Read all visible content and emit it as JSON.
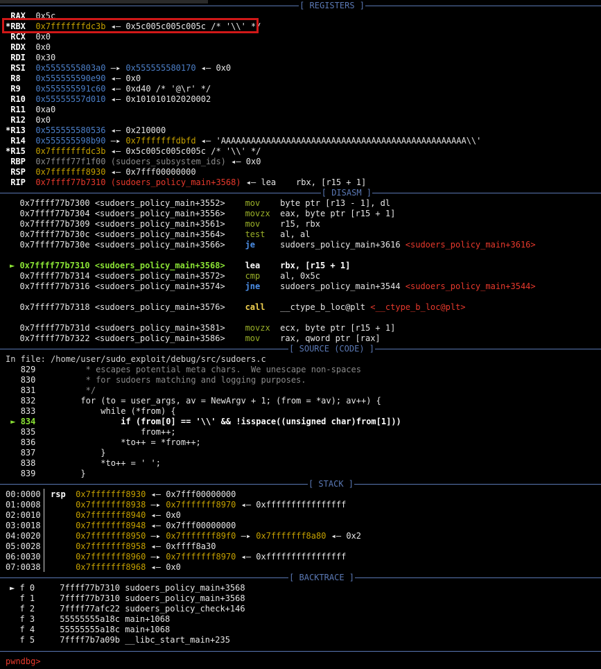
{
  "sections": {
    "registers": "[ REGISTERS ]",
    "disasm": "[ DISASM ]",
    "source": "[ SOURCE (CODE) ]",
    "stack": "[ STACK ]",
    "backtrace": "[ BACKTRACE ]"
  },
  "registers": [
    {
      "name": " RAX",
      "v1": "0x5c",
      "rest": ""
    },
    {
      "name": "*RBX",
      "v1": "0x7fffffffdc3b",
      "rest": " ◂— 0x5c005c005c005c /* '\\\\' */"
    },
    {
      "name": " RCX",
      "v1": "0x0",
      "rest": ""
    },
    {
      "name": " RDX",
      "v1": "0x0",
      "rest": ""
    },
    {
      "name": " RDI",
      "v1": "0x30",
      "rest": ""
    },
    {
      "name": " RSI",
      "v1": "0x5555555803a0",
      "mid": " —▸ ",
      "v2": "0x555555580170",
      "rest": " ◂— 0x0"
    },
    {
      "name": " R8",
      "v1": "0x555555590e90",
      "rest": " ◂— 0x0"
    },
    {
      "name": " R9",
      "v1": "0x555555591c60",
      "rest": " ◂— 0xd40 /* '@\\r' */"
    },
    {
      "name": " R10",
      "v1": "0x55555557d010",
      "rest": " ◂— 0x101010102020002"
    },
    {
      "name": " R11",
      "v1": "0xa0",
      "rest": ""
    },
    {
      "name": " R12",
      "v1": "0x0",
      "rest": ""
    },
    {
      "name": "*R13",
      "v1": "0x555555580536",
      "rest": " ◂— 0x210000"
    },
    {
      "name": " R14",
      "v1": "0x555555598b90",
      "mid": " —▸ ",
      "v2": "0x7fffffffdbfd",
      "rest": " ◂— 'AAAAAAAAAAAAAAAAAAAAAAAAAAAAAAAAAAAAAAAAAAAAAAAAA\\\\'"
    },
    {
      "name": "*R15",
      "v1": "0x7fffffffdc3b",
      "rest": " ◂— 0x5c005c005c005c /* '\\\\' */"
    },
    {
      "name": " RBP",
      "v1": "0x7ffff77f1f00 (sudoers_subsystem_ids)",
      "rest": " ◂— 0x0"
    },
    {
      "name": " RSP",
      "v1": "0x7fffffff8930",
      "rest": " ◂— 0x7fff00000000"
    },
    {
      "name": " RIP",
      "v1": "0x7ffff77b7310 (sudoers_policy_main+3568)",
      "rest": " ◂— lea    rbx, [r15 + 1]"
    }
  ],
  "disasm": [
    {
      "addr": "0x7ffff77b7300",
      "sym": "<sudoers_policy_main+3552>",
      "mn": "mov",
      "ops": "byte ptr [r13 - 1], dl",
      "cur": false
    },
    {
      "addr": "0x7ffff77b7304",
      "sym": "<sudoers_policy_main+3556>",
      "mn": "movzx",
      "ops": "eax, byte ptr [r15 + 1]",
      "cur": false
    },
    {
      "addr": "0x7ffff77b7309",
      "sym": "<sudoers_policy_main+3561>",
      "mn": "mov",
      "ops": "r15, rbx",
      "cur": false
    },
    {
      "addr": "0x7ffff77b730c",
      "sym": "<sudoers_policy_main+3564>",
      "mn": "test",
      "ops": "al, al",
      "cur": false
    },
    {
      "addr": "0x7ffff77b730e",
      "sym": "<sudoers_policy_main+3566>",
      "mn": "je",
      "ops": "sudoers_policy_main+3616",
      "tgt": "<sudoers_policy_main+3616>",
      "cur": false
    },
    {
      "addr": "0x7ffff77b7310",
      "sym": "<sudoers_policy_main+3568>",
      "mn": "lea",
      "ops": "rbx, [r15 + 1]",
      "cur": true
    },
    {
      "addr": "0x7ffff77b7314",
      "sym": "<sudoers_policy_main+3572>",
      "mn": "cmp",
      "ops": "al, 0x5c",
      "cur": false
    },
    {
      "addr": "0x7ffff77b7316",
      "sym": "<sudoers_policy_main+3574>",
      "mn": "jne",
      "ops": "sudoers_policy_main+3544",
      "tgt": "<sudoers_policy_main+3544>",
      "cur": false
    },
    {
      "addr": "0x7ffff77b7318",
      "sym": "<sudoers_policy_main+3576>",
      "mn": "call",
      "ops": "__ctype_b_loc@plt",
      "tgt": "<__ctype_b_loc@plt>",
      "cur": false
    },
    {
      "addr": "0x7ffff77b731d",
      "sym": "<sudoers_policy_main+3581>",
      "mn": "movzx",
      "ops": "ecx, byte ptr [r15 + 1]",
      "cur": false
    },
    {
      "addr": "0x7ffff77b7322",
      "sym": "<sudoers_policy_main+3586>",
      "mn": "mov",
      "ops": "rax, qword ptr [rax]",
      "cur": false
    }
  ],
  "source": {
    "file_line": "In file: /home/user/sudo_exploit/debug/src/sudoers.c",
    "lines": [
      {
        "n": "829",
        "code": "         * escapes potential meta chars.  We unescape non-spaces"
      },
      {
        "n": "830",
        "code": "         * for sudoers matching and logging purposes."
      },
      {
        "n": "831",
        "code": "         */"
      },
      {
        "n": "832",
        "code": "        for (to = user_args, av = NewArgv + 1; (from = *av); av++) {"
      },
      {
        "n": "833",
        "code": "            while (*from) {"
      },
      {
        "n": "834",
        "code": "                if (from[0] == '\\\\' && !isspace((unsigned char)from[1]))"
      },
      {
        "n": "835",
        "code": "                    from++;"
      },
      {
        "n": "836",
        "code": "                *to++ = *from++;"
      },
      {
        "n": "837",
        "code": "            }"
      },
      {
        "n": "838",
        "code": "            *to++ = ' ';"
      },
      {
        "n": "839",
        "code": "        }"
      }
    ]
  },
  "stack": [
    {
      "idx": "00:0000",
      "reg": "rsp",
      "addr": "0x7fffffff8930",
      "chain": " ◂— 0x7fff00000000"
    },
    {
      "idx": "01:0008",
      "reg": "",
      "addr": "0x7fffffff8938",
      "mid": " —▸ ",
      "a2": "0x7fffffff8970",
      "chain": " ◂— 0xffffffffffffffff"
    },
    {
      "idx": "02:0010",
      "reg": "",
      "addr": "0x7fffffff8940",
      "chain": " ◂— 0x0"
    },
    {
      "idx": "03:0018",
      "reg": "",
      "addr": "0x7fffffff8948",
      "chain": " ◂— 0x7fff00000000"
    },
    {
      "idx": "04:0020",
      "reg": "",
      "addr": "0x7fffffff8950",
      "mid": " —▸ ",
      "a2": "0x7fffffff89f0",
      "mid2": " —▸ ",
      "a3": "0x7fffffff8a80",
      "chain": " ◂— 0x2"
    },
    {
      "idx": "05:0028",
      "reg": "",
      "addr": "0x7fffffff8958",
      "chain": " ◂— 0xffff8a30"
    },
    {
      "idx": "06:0030",
      "reg": "",
      "addr": "0x7fffffff8960",
      "mid": " —▸ ",
      "a2": "0x7fffffff8970",
      "chain": " ◂— 0xffffffffffffffff"
    },
    {
      "idx": "07:0038",
      "reg": "",
      "addr": "0x7fffffff8968",
      "chain": " ◂— 0x0"
    }
  ],
  "backtrace": [
    {
      "mark": "►",
      "f": "f 0",
      "addr": "7ffff77b7310",
      "sym": "sudoers_policy_main+3568"
    },
    {
      "mark": " ",
      "f": "f 1",
      "addr": "7ffff77b7310",
      "sym": "sudoers_policy_main+3568"
    },
    {
      "mark": " ",
      "f": "f 2",
      "addr": "7ffff77afc22",
      "sym": "sudoers_policy_check+146"
    },
    {
      "mark": " ",
      "f": "f 3",
      "addr": "55555555a18c",
      "sym": "main+1068"
    },
    {
      "mark": " ",
      "f": "f 4",
      "addr": "55555555a18c",
      "sym": "main+1068"
    },
    {
      "mark": " ",
      "f": "f 5",
      "addr": "7ffff7b7a09b",
      "sym": "__libc_start_main+235"
    }
  ],
  "prompt": "pwndbg>"
}
